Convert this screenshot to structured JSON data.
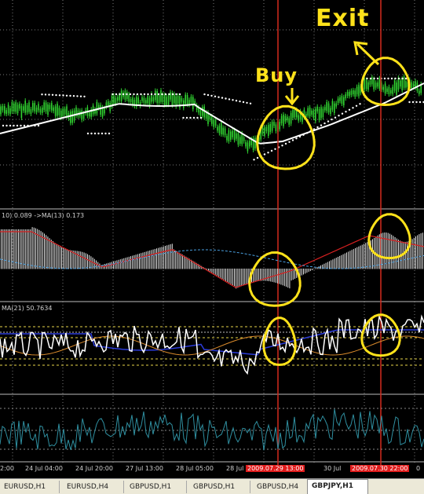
{
  "indicators": {
    "macd_label": "10) 0.089 ->MA(13) 0.173",
    "rsi_label": "MA(21) 50.7634"
  },
  "annotations": {
    "buy": "Buy",
    "exit": "Exit"
  },
  "time_axis": {
    "ticks": [
      "2:00",
      "24 Jul 04:00",
      "24 Jul 20:00",
      "27 Jul 13:00",
      "28 Jul 05:00",
      "28 Jul",
      "2009.07.29 13:00",
      "30 Jul",
      "2009.07.30 22:00",
      "0"
    ]
  },
  "tabs": [
    {
      "label": "EURUSD,H1"
    },
    {
      "label": "EURUSD,H4"
    },
    {
      "label": "GBPUSD,H1"
    },
    {
      "label": "GBPUSD,H1"
    },
    {
      "label": "GBPUSD,H4"
    },
    {
      "label": "GBPJPY,H1"
    }
  ],
  "colors": {
    "candle": "#31d431",
    "ma": "#ffffff",
    "psar": "#ffffff",
    "vline": "#d42a1e",
    "annotation": "#ffe21a",
    "rsi_ma": "#2b3bd8",
    "stoch": "#2f8fa0"
  }
}
